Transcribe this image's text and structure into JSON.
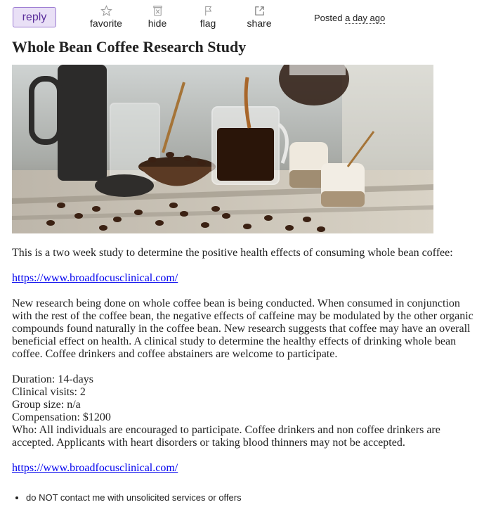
{
  "toolbar": {
    "reply_label": "reply",
    "items": [
      {
        "label": "favorite",
        "icon": "star-icon"
      },
      {
        "label": "hide",
        "icon": "trash-icon"
      },
      {
        "label": "flag",
        "icon": "flag-icon"
      },
      {
        "label": "share",
        "icon": "share-icon"
      }
    ],
    "posted_prefix": "Posted",
    "posted_ago": "a day ago"
  },
  "post": {
    "title": "Whole Bean Coffee Research Study",
    "image_icon": "coffee-photo",
    "intro": "This is a two week study to determine the positive health effects of consuming whole bean coffee:",
    "link1": "https://www.broadfocusclinical.com/",
    "description": "New research being done on whole coffee bean is being conducted. When consumed in conjunction with the rest of the coffee bean, the negative effects of caffeine may be modulated by the other organic compounds found naturally in the coffee bean. New research suggests that coffee may have an overall beneficial effect on health. A clinical study to determine the healthy effects of drinking whole bean coffee. Coffee drinkers and coffee abstainers are welcome to participate.",
    "details": {
      "duration": "Duration: 14-days",
      "visits": "Clinical visits: 2",
      "group_size": "Group size: n/a",
      "compensation": "Compensation: $1200",
      "who": "Who: All individuals are encouraged to participate. Coffee drinkers and non coffee drinkers are accepted. Applicants with heart disorders or taking blood thinners may not be accepted."
    },
    "link2": "https://www.broadfocusclinical.com/"
  },
  "notices": [
    "do NOT contact me with unsolicited services or offers"
  ],
  "colors": {
    "reply_bg": "#e9e0f6",
    "reply_border": "#9b7bd1",
    "link": "#0000ee"
  }
}
